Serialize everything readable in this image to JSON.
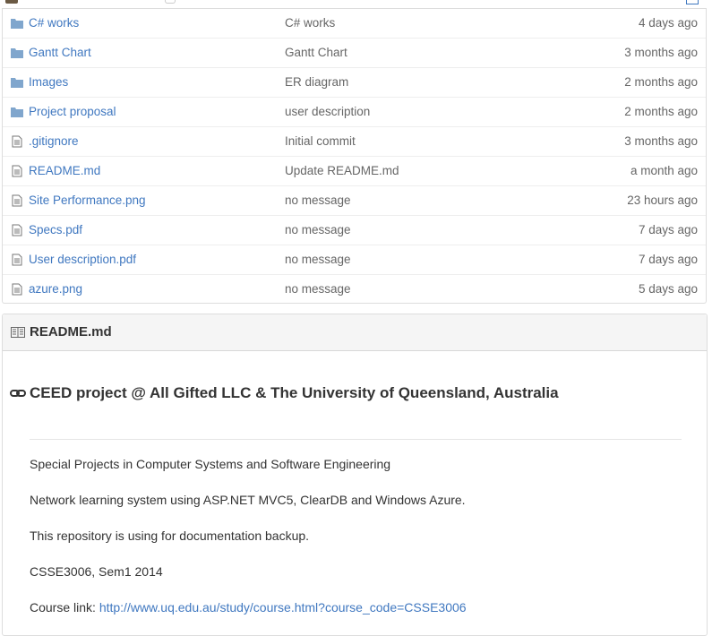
{
  "files": [
    {
      "type": "folder",
      "name": "C# works",
      "message": "C# works",
      "age": "4 days ago"
    },
    {
      "type": "folder",
      "name": "Gantt Chart",
      "message": "Gantt Chart",
      "age": "3 months ago"
    },
    {
      "type": "folder",
      "name": "Images",
      "message": "ER diagram",
      "age": "2 months ago"
    },
    {
      "type": "folder",
      "name": "Project proposal",
      "message": "user description",
      "age": "2 months ago"
    },
    {
      "type": "file",
      "name": ".gitignore",
      "message": "Initial commit",
      "age": "3 months ago"
    },
    {
      "type": "file",
      "name": "README.md",
      "message": "Update README.md",
      "age": "a month ago"
    },
    {
      "type": "file",
      "name": "Site Performance.png",
      "message": "no message",
      "age": "23 hours ago"
    },
    {
      "type": "file",
      "name": "Specs.pdf",
      "message": "no message",
      "age": "7 days ago"
    },
    {
      "type": "file",
      "name": "User description.pdf",
      "message": "no message",
      "age": "7 days ago"
    },
    {
      "type": "file",
      "name": "azure.png",
      "message": "no message",
      "age": "5 days ago"
    }
  ],
  "readme": {
    "title": "README.md",
    "heading": "CEED project @ All Gifted LLC & The University of Queensland, Australia",
    "paragraphs": [
      "Special Projects in Computer Systems and Software Engineering",
      "Network learning system using ASP.NET MVC5, ClearDB and Windows Azure.",
      "This repository is using for documentation backup.",
      "CSSE3006, Sem1 2014"
    ],
    "course_label": "Course link: ",
    "course_link": "http://www.uq.edu.au/study/course.html?course_code=CSSE3006"
  },
  "colors": {
    "link": "#4078c0",
    "folder": "#80a6cd",
    "text": "#333333",
    "muted": "#666666"
  }
}
